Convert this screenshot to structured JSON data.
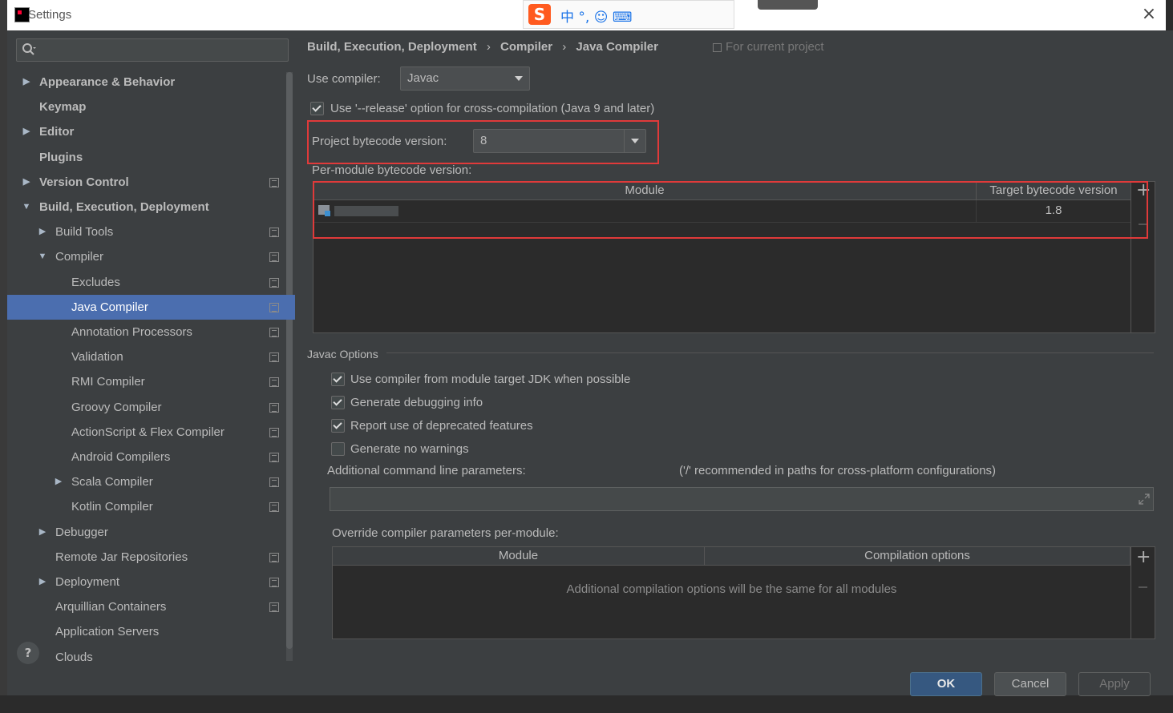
{
  "window": {
    "title": "Settings"
  },
  "search": {
    "placeholder": ""
  },
  "sidebar": {
    "items": [
      {
        "label": "Appearance & Behavior",
        "arrow": "▶",
        "bold": true,
        "proj": false
      },
      {
        "label": "Keymap",
        "arrow": "",
        "bold": true,
        "proj": false
      },
      {
        "label": "Editor",
        "arrow": "▶",
        "bold": true,
        "proj": false
      },
      {
        "label": "Plugins",
        "arrow": "",
        "bold": true,
        "proj": false
      },
      {
        "label": "Version Control",
        "arrow": "▶",
        "bold": true,
        "proj": true
      },
      {
        "label": "Build, Execution, Deployment",
        "arrow": "▼",
        "bold": true,
        "proj": false
      },
      {
        "label": "Build Tools",
        "arrow": "▶",
        "bold": false,
        "proj": true
      },
      {
        "label": "Compiler",
        "arrow": "▼",
        "bold": false,
        "proj": true
      },
      {
        "label": "Excludes",
        "arrow": "",
        "bold": false,
        "proj": true
      },
      {
        "label": "Java Compiler",
        "arrow": "",
        "bold": false,
        "proj": true,
        "selected": true
      },
      {
        "label": "Annotation Processors",
        "arrow": "",
        "bold": false,
        "proj": true
      },
      {
        "label": "Validation",
        "arrow": "",
        "bold": false,
        "proj": true
      },
      {
        "label": "RMI Compiler",
        "arrow": "",
        "bold": false,
        "proj": true
      },
      {
        "label": "Groovy Compiler",
        "arrow": "",
        "bold": false,
        "proj": true
      },
      {
        "label": "ActionScript & Flex Compiler",
        "arrow": "",
        "bold": false,
        "proj": true
      },
      {
        "label": "Android Compilers",
        "arrow": "",
        "bold": false,
        "proj": true
      },
      {
        "label": "Scala Compiler",
        "arrow": "▶",
        "bold": false,
        "proj": true
      },
      {
        "label": "Kotlin Compiler",
        "arrow": "",
        "bold": false,
        "proj": true
      },
      {
        "label": "Debugger",
        "arrow": "▶",
        "bold": false,
        "proj": false
      },
      {
        "label": "Remote Jar Repositories",
        "arrow": "",
        "bold": false,
        "proj": true
      },
      {
        "label": "Deployment",
        "arrow": "▶",
        "bold": false,
        "proj": true
      },
      {
        "label": "Arquillian Containers",
        "arrow": "",
        "bold": false,
        "proj": true
      },
      {
        "label": "Application Servers",
        "arrow": "",
        "bold": false,
        "proj": false
      },
      {
        "label": "Clouds",
        "arrow": "",
        "bold": false,
        "proj": false
      }
    ]
  },
  "breadcrumb": {
    "parts": [
      "Build, Execution, Deployment",
      "›",
      "Compiler",
      "›",
      "Java Compiler"
    ],
    "scope": "For current project"
  },
  "compiler": {
    "use_compiler_label": "Use compiler:",
    "use_compiler_value": "Javac",
    "release_option_label": "Use '--release' option for cross-compilation (Java 9 and later)",
    "release_option_checked": true,
    "project_bytecode_label": "Project bytecode version:",
    "project_bytecode_value": "8",
    "per_module_label": "Per-module bytecode version:",
    "module_table": {
      "headers": [
        "Module",
        "Target bytecode version"
      ],
      "rows": [
        {
          "module": "",
          "target": "1.8"
        }
      ]
    }
  },
  "javac_options": {
    "section_label": "Javac Options",
    "checkboxes": [
      {
        "label": "Use compiler from module target JDK when possible",
        "checked": true
      },
      {
        "label": "Generate debugging info",
        "checked": true
      },
      {
        "label": "Report use of deprecated features",
        "checked": true
      },
      {
        "label": "Generate no warnings",
        "checked": false
      }
    ],
    "additional_params_label": "Additional command line parameters:",
    "additional_params_hint": "('/' recommended in paths for cross-platform configurations)",
    "additional_params_value": "",
    "override_label": "Override compiler parameters per-module:",
    "override_table": {
      "headers": [
        "Module",
        "Compilation options"
      ],
      "empty_text": "Additional compilation options will be the same for all modules"
    }
  },
  "buttons": {
    "ok": "OK",
    "cancel": "Cancel",
    "apply": "Apply",
    "help": "?"
  },
  "colors": {
    "selection": "#4b6eaf",
    "highlight_box": "#e03a3a",
    "ok_button": "#365880"
  },
  "ime": {
    "glyph": "S",
    "text": "中 °, ☺ ⌨"
  }
}
